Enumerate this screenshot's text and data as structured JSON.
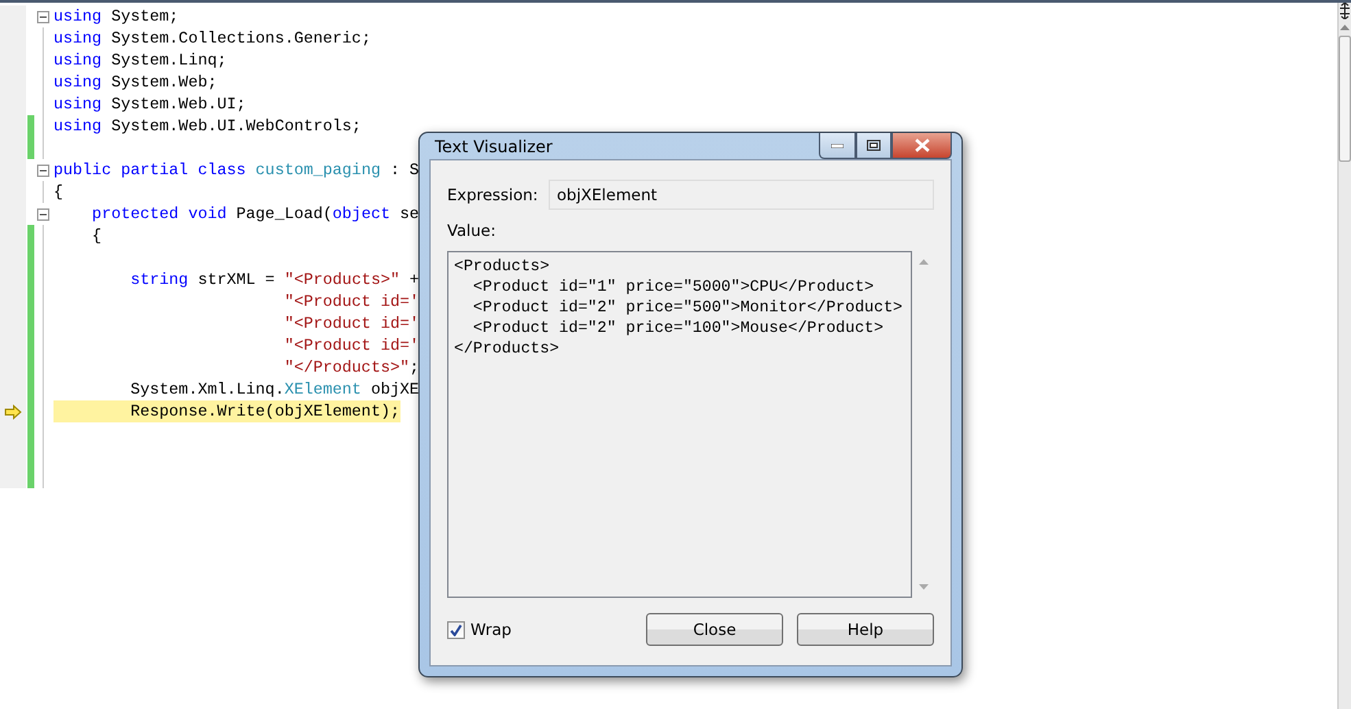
{
  "editor": {
    "lines": [
      {
        "fold": true,
        "changed": false,
        "current": false,
        "tokens": [
          {
            "kind": "keyword",
            "text": "using"
          },
          {
            "kind": "plain",
            "text": " System;"
          }
        ]
      },
      {
        "fold": false,
        "changed": false,
        "current": false,
        "tokens": [
          {
            "kind": "keyword",
            "text": "using"
          },
          {
            "kind": "plain",
            "text": " System.Collections.Generic;"
          }
        ]
      },
      {
        "fold": false,
        "changed": false,
        "current": false,
        "tokens": [
          {
            "kind": "keyword",
            "text": "using"
          },
          {
            "kind": "plain",
            "text": " System.Linq;"
          }
        ]
      },
      {
        "fold": false,
        "changed": false,
        "current": false,
        "tokens": [
          {
            "kind": "keyword",
            "text": "using"
          },
          {
            "kind": "plain",
            "text": " System.Web;"
          }
        ]
      },
      {
        "fold": false,
        "changed": false,
        "current": false,
        "tokens": [
          {
            "kind": "keyword",
            "text": "using"
          },
          {
            "kind": "plain",
            "text": " System.Web.UI;"
          }
        ]
      },
      {
        "fold": false,
        "changed": true,
        "current": false,
        "tokens": [
          {
            "kind": "keyword",
            "text": "using"
          },
          {
            "kind": "plain",
            "text": " System.Web.UI.WebControls;"
          }
        ]
      },
      {
        "fold": false,
        "changed": true,
        "current": false
      },
      {
        "fold": true,
        "changed": false,
        "current": false,
        "tokens": [
          {
            "kind": "keyword",
            "text": "public partial class"
          },
          {
            "kind": "type",
            "text": " custom_paging"
          },
          {
            "kind": "plain",
            "text": " : S"
          }
        ]
      },
      {
        "fold": false,
        "changed": false,
        "current": false,
        "tokens": [
          {
            "kind": "plain",
            "text": "{"
          }
        ]
      },
      {
        "fold": true,
        "changed": false,
        "current": false,
        "tokens": [
          {
            "kind": "keyword",
            "text": "    protected void"
          },
          {
            "kind": "plain",
            "text": " Page_Load("
          },
          {
            "kind": "keyword",
            "text": "object"
          },
          {
            "kind": "plain",
            "text": " se"
          }
        ]
      },
      {
        "fold": false,
        "changed": true,
        "current": false,
        "tokens": [
          {
            "kind": "plain",
            "text": "    {"
          }
        ]
      },
      {
        "fold": false,
        "changed": true,
        "current": false
      },
      {
        "fold": false,
        "changed": true,
        "current": false,
        "tokens": [
          {
            "kind": "keyword",
            "text": "        string"
          },
          {
            "kind": "plain",
            "text": " strXML = "
          },
          {
            "kind": "string",
            "text": "\"<Products>\""
          },
          {
            "kind": "plain",
            "text": " +"
          }
        ]
      },
      {
        "fold": false,
        "changed": true,
        "current": false,
        "tokens": [
          {
            "kind": "string",
            "text": "                        \"<Product id='"
          }
        ]
      },
      {
        "fold": false,
        "changed": true,
        "current": false,
        "tokens": [
          {
            "kind": "string",
            "text": "                        \"<Product id='"
          }
        ]
      },
      {
        "fold": false,
        "changed": true,
        "current": false,
        "tokens": [
          {
            "kind": "string",
            "text": "                        \"<Product id='"
          }
        ]
      },
      {
        "fold": false,
        "changed": true,
        "current": false,
        "tokens": [
          {
            "kind": "string",
            "text": "                        \"</Products>\""
          },
          {
            "kind": "plain",
            "text": ";"
          }
        ]
      },
      {
        "fold": false,
        "changed": true,
        "current": false,
        "tokens": [
          {
            "kind": "plain",
            "text": "        System.Xml.Linq."
          },
          {
            "kind": "type",
            "text": "XElement"
          },
          {
            "kind": "plain",
            "text": " objXE"
          }
        ]
      },
      {
        "fold": false,
        "changed": true,
        "current": true,
        "tokens": [
          {
            "kind": "plain",
            "text": "        Response.Write(objXElement);"
          }
        ]
      },
      {
        "fold": false,
        "changed": true,
        "current": false
      },
      {
        "fold": false,
        "changed": true,
        "current": false
      },
      {
        "fold": false,
        "changed": true,
        "current": false
      }
    ]
  },
  "dialog": {
    "title": "Text Visualizer",
    "expression": {
      "label": "Expression:",
      "value": "objXElement"
    },
    "value": {
      "label": "Value:",
      "lines": [
        "<Products>",
        "  <Product id=\"1\" price=\"5000\">CPU</Product>",
        "  <Product id=\"2\" price=\"500\">Monitor</Product>",
        "  <Product id=\"2\" price=\"100\">Mouse</Product>",
        "</Products>"
      ]
    },
    "wrap": {
      "label": "Wrap",
      "checked": true
    },
    "buttons": [
      "Close",
      "Help"
    ]
  }
}
